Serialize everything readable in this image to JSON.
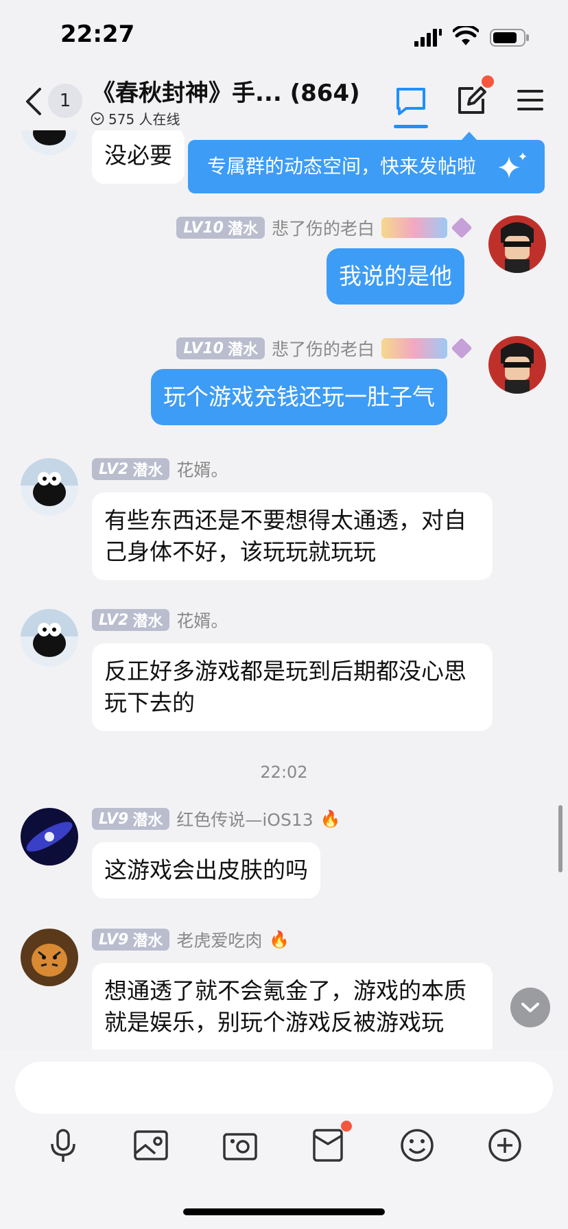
{
  "status_bar": {
    "time": "22:27"
  },
  "header": {
    "unread_count": "1",
    "title": "《春秋封神》手... (864)",
    "online_text": "575 人在线"
  },
  "tooltip": {
    "text": "专属群的动态空间，快来发帖啦"
  },
  "messages": [
    {
      "text": "没必要"
    },
    {
      "lv": "10",
      "rank": "潜水",
      "name": "悲了伤的老白",
      "text": "我说的是他"
    },
    {
      "lv": "10",
      "rank": "潜水",
      "name": "悲了伤的老白",
      "text": "玩个游戏充钱还玩一肚子气"
    },
    {
      "lv": "2",
      "rank": "潜水",
      "name": "花婿。",
      "text": "有些东西还是不要想得太通透，对自己身体不好，该玩玩就玩玩"
    },
    {
      "lv": "2",
      "rank": "潜水",
      "name": "花婿。",
      "text": "反正好多游戏都是玩到后期都没心思玩下去的"
    },
    {
      "lv": "9",
      "rank": "潜水",
      "name": "红色传说—iOS13",
      "text": "这游戏会出皮肤的吗"
    },
    {
      "lv": "9",
      "rank": "潜水",
      "name": "老虎爱吃肉",
      "text": "想通透了就不会氪金了，游戏的本质就是娱乐，别玩个游戏反被游戏玩"
    }
  ],
  "timestamp": "22:02",
  "input": {
    "placeholder": ""
  },
  "colors": {
    "accent": "#3d9cf5",
    "badge_red": "#f4573f",
    "level_badge": "#b9bdce"
  },
  "icons": [
    "back-icon",
    "chat-icon",
    "edit-icon",
    "menu-icon",
    "microphone-icon",
    "photo-icon",
    "camera-icon",
    "red-packet-icon",
    "emoji-icon",
    "plus-icon"
  ]
}
